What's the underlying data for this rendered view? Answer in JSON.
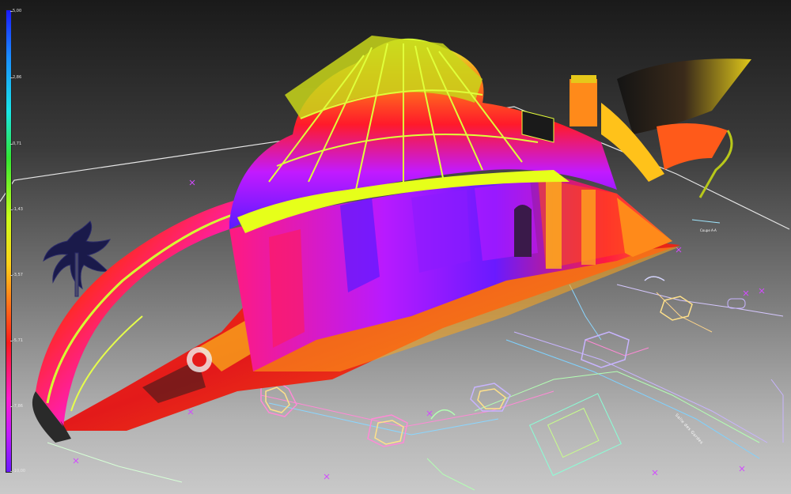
{
  "colors": {
    "background_top": "#1a1a1a",
    "background_bottom": "#c9c9c9",
    "scale_top": "#1a1aff",
    "scale_bottom": "#6a1aff"
  },
  "scale": {
    "ticks": [
      "5,00",
      "2,86",
      "0,71",
      "-1,43",
      "-3,57",
      "-5,71",
      "-7,86",
      "-10,00"
    ]
  },
  "plan": {
    "label": "Salle des Gardes",
    "nav_label": "Coupe A-A"
  }
}
